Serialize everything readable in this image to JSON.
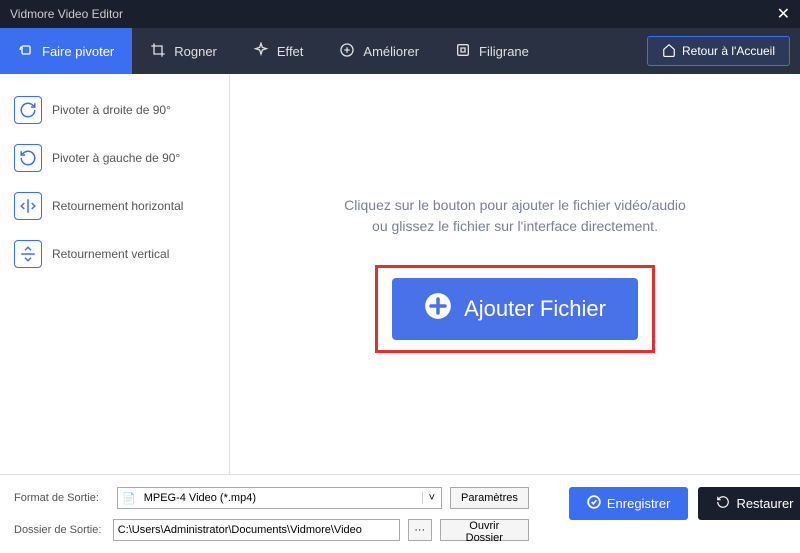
{
  "titlebar": {
    "title": "Vidmore Video Editor"
  },
  "toolbar": {
    "tabs": [
      {
        "label": "Faire pivoter"
      },
      {
        "label": "Rogner"
      },
      {
        "label": "Effet"
      },
      {
        "label": "Améliorer"
      },
      {
        "label": "Filigrane"
      }
    ],
    "home_label": "Retour à l'Accueil"
  },
  "sidebar": {
    "items": [
      {
        "label": "Pivoter à droite de 90°"
      },
      {
        "label": "Pivoter à gauche de 90°"
      },
      {
        "label": "Retournement horizontal"
      },
      {
        "label": "Retournement vertical"
      }
    ]
  },
  "content": {
    "hint": "Cliquez sur le bouton pour ajouter le fichier vidéo/audio ou glissez le fichier sur l'interface directement.",
    "add_label": "Ajouter Fichier"
  },
  "footer": {
    "format_label": "Format de Sortie:",
    "format_value": "MPEG-4 Video (*.mp4)",
    "params_label": "Paramètres",
    "folder_label": "Dossier de Sortie:",
    "folder_value": "C:\\Users\\Administrator\\Documents\\Vidmore\\Video",
    "open_folder_label": "Ouvrir Dossier",
    "save_label": "Enregistrer",
    "restore_label": "Restaurer"
  }
}
